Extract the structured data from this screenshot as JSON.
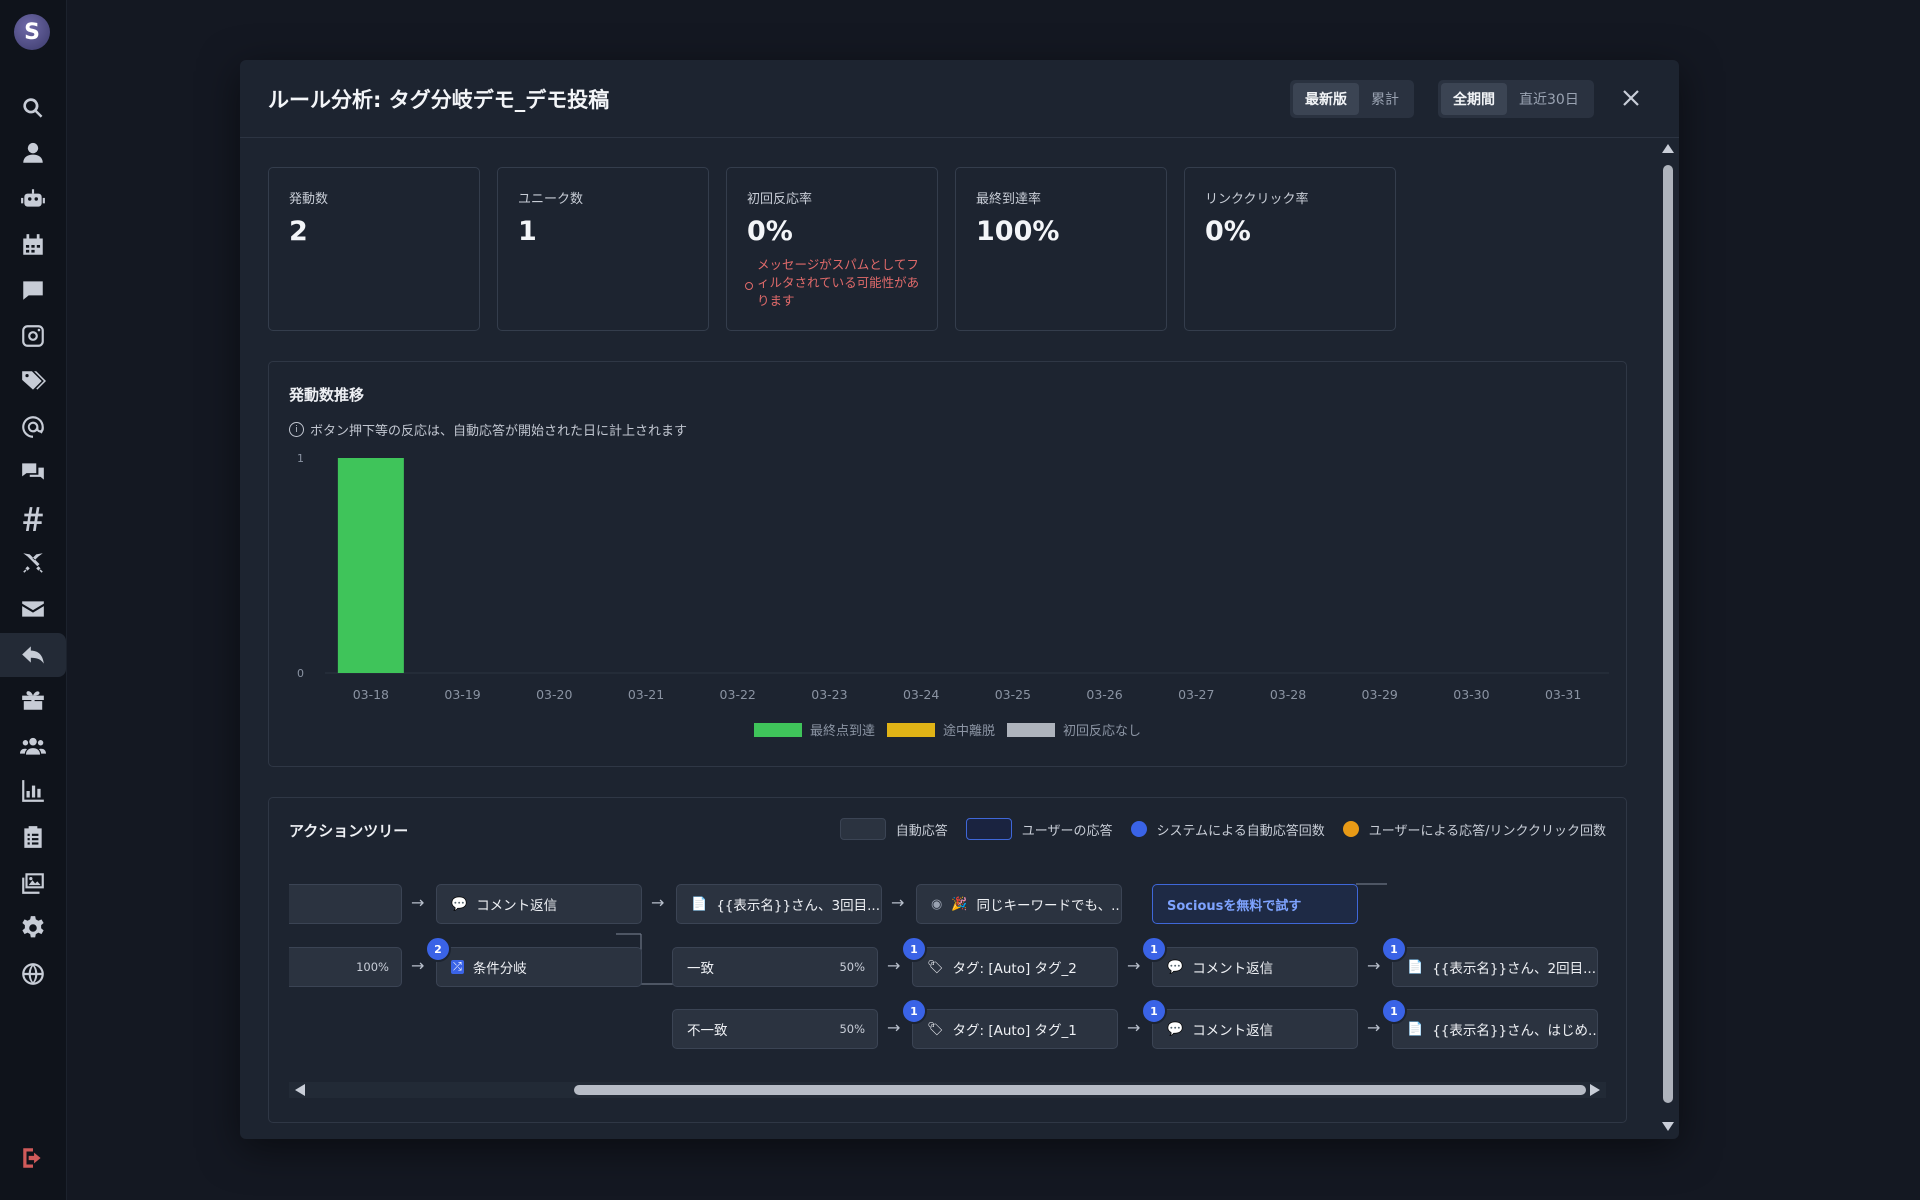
{
  "sidebar": {
    "logo": "S",
    "items": [
      {
        "name": "search-icon"
      },
      {
        "name": "user-icon"
      },
      {
        "name": "robot-icon"
      },
      {
        "name": "calendar-icon"
      },
      {
        "name": "comment-icon"
      },
      {
        "name": "instagram-icon"
      },
      {
        "name": "tags-icon"
      },
      {
        "name": "at-icon"
      },
      {
        "name": "comments-icon"
      },
      {
        "name": "hashtag-icon"
      },
      {
        "name": "swords-icon"
      },
      {
        "name": "mail-icon"
      },
      {
        "name": "reply-icon"
      },
      {
        "name": "gift-icon"
      },
      {
        "name": "users-icon"
      },
      {
        "name": "chart-icon"
      },
      {
        "name": "clipboard-icon"
      },
      {
        "name": "images-icon"
      },
      {
        "name": "gear-icon"
      },
      {
        "name": "globe-icon"
      }
    ],
    "logout": "logout-icon"
  },
  "modal": {
    "title": "ルール分析: タグ分岐デモ_デモ投稿",
    "version_toggle": {
      "options": [
        "最新版",
        "累計"
      ],
      "selected": "最新版"
    },
    "period_toggle": {
      "options": [
        "全期間",
        "直近30日"
      ],
      "selected": "全期間"
    }
  },
  "stats": [
    {
      "label": "発動数",
      "value": "2"
    },
    {
      "label": "ユニーク数",
      "value": "1"
    },
    {
      "label": "初回反応率",
      "value": "0%",
      "warning": "メッセージがスパムとしてフィルタされている可能性があります"
    },
    {
      "label": "最終到達率",
      "value": "100%"
    },
    {
      "label": "リンククリック率",
      "value": "0%"
    }
  ],
  "chart_panel": {
    "title": "発動数推移",
    "note": "ボタン押下等の反応は、自動応答が開始された日に計上されます"
  },
  "chart_data": {
    "type": "bar",
    "categories": [
      "03-18",
      "03-19",
      "03-20",
      "03-21",
      "03-22",
      "03-23",
      "03-24",
      "03-25",
      "03-26",
      "03-27",
      "03-28",
      "03-29",
      "03-30",
      "03-31"
    ],
    "series": [
      {
        "name": "最終点到達",
        "color": "#3fc45a",
        "values": [
          1,
          0,
          0,
          0,
          0,
          0,
          0,
          0,
          0,
          0,
          0,
          0,
          0,
          0
        ]
      },
      {
        "name": "途中離脱",
        "color": "#e0b316",
        "values": [
          0,
          0,
          0,
          0,
          0,
          0,
          0,
          0,
          0,
          0,
          0,
          0,
          0,
          0
        ]
      },
      {
        "name": "初回反応なし",
        "color": "#aeb3bc",
        "values": [
          0,
          0,
          0,
          0,
          0,
          0,
          0,
          0,
          0,
          0,
          0,
          0,
          0,
          0
        ]
      }
    ],
    "stacked": true,
    "ylim": [
      0,
      1
    ],
    "yticks": [
      "0",
      "1"
    ]
  },
  "tree": {
    "title": "アクションツリー",
    "legend": {
      "auto": "自動応答",
      "user": "ユーザーの応答",
      "sys_count": "システムによる自動応答回数",
      "user_count": "ユーザーによる応答/リンククリック回数"
    },
    "row1": {
      "start_pct": "",
      "n1": "コメント返信",
      "n2": "{{表示名}}さん、3回目...",
      "n3": "同じキーワードでも、...",
      "cta": "Sociousを無料で試す"
    },
    "row2": {
      "start_pct": "100%",
      "branch": "条件分岐",
      "branch_count": "2",
      "match": "一致",
      "match_pct": "50%",
      "tag2": "タグ: [Auto] タグ_2",
      "reply": "コメント返信",
      "msg": "{{表示名}}さん、2回目...",
      "count": "1"
    },
    "row3": {
      "nomatch": "不一致",
      "nomatch_pct": "50%",
      "tag1": "タグ: [Auto] タグ_1",
      "reply": "コメント返信",
      "msg": "{{表示名}}さん、はじめ...",
      "count": "1"
    }
  }
}
